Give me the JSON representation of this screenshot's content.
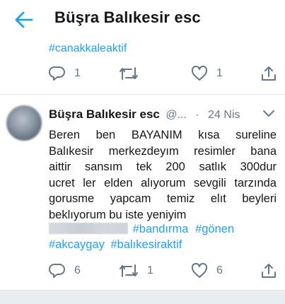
{
  "header": {
    "title": "Büşra Balıkesir esc",
    "back_icon": "arrow-left-icon",
    "accent_color": "#1da1f2"
  },
  "previous_tweet": {
    "hashtag": "#canakkaleaktif",
    "actions": {
      "reply_count": "1",
      "retweet_count": "",
      "like_count": "1"
    }
  },
  "tweet": {
    "display_name": "Büşra Balıkesir esc",
    "handle": "@...",
    "separator": "·",
    "date": "24 Nis",
    "body_lines": [
      "Beren  ben  BAYANIM  kısa sureline",
      "Balıkesir merkezdeyım resimler bana",
      "aittir sansım tek 200 satlık 300dur",
      "ucret ler elden alıyorum sevgili tarzında",
      "gorusme yapcam temiz elıt beyleri",
      "beklıyorum bu iste yeniyim"
    ],
    "hashtags": [
      "#bandırma",
      "#gönen",
      "#akcaygay",
      "#balıkesiraktif"
    ],
    "actions": {
      "reply_count": "6",
      "retweet_count": "1",
      "like_count": "6"
    }
  },
  "colors": {
    "text_primary": "#14171a",
    "text_secondary": "#657786",
    "divider": "#e1e8ed"
  }
}
